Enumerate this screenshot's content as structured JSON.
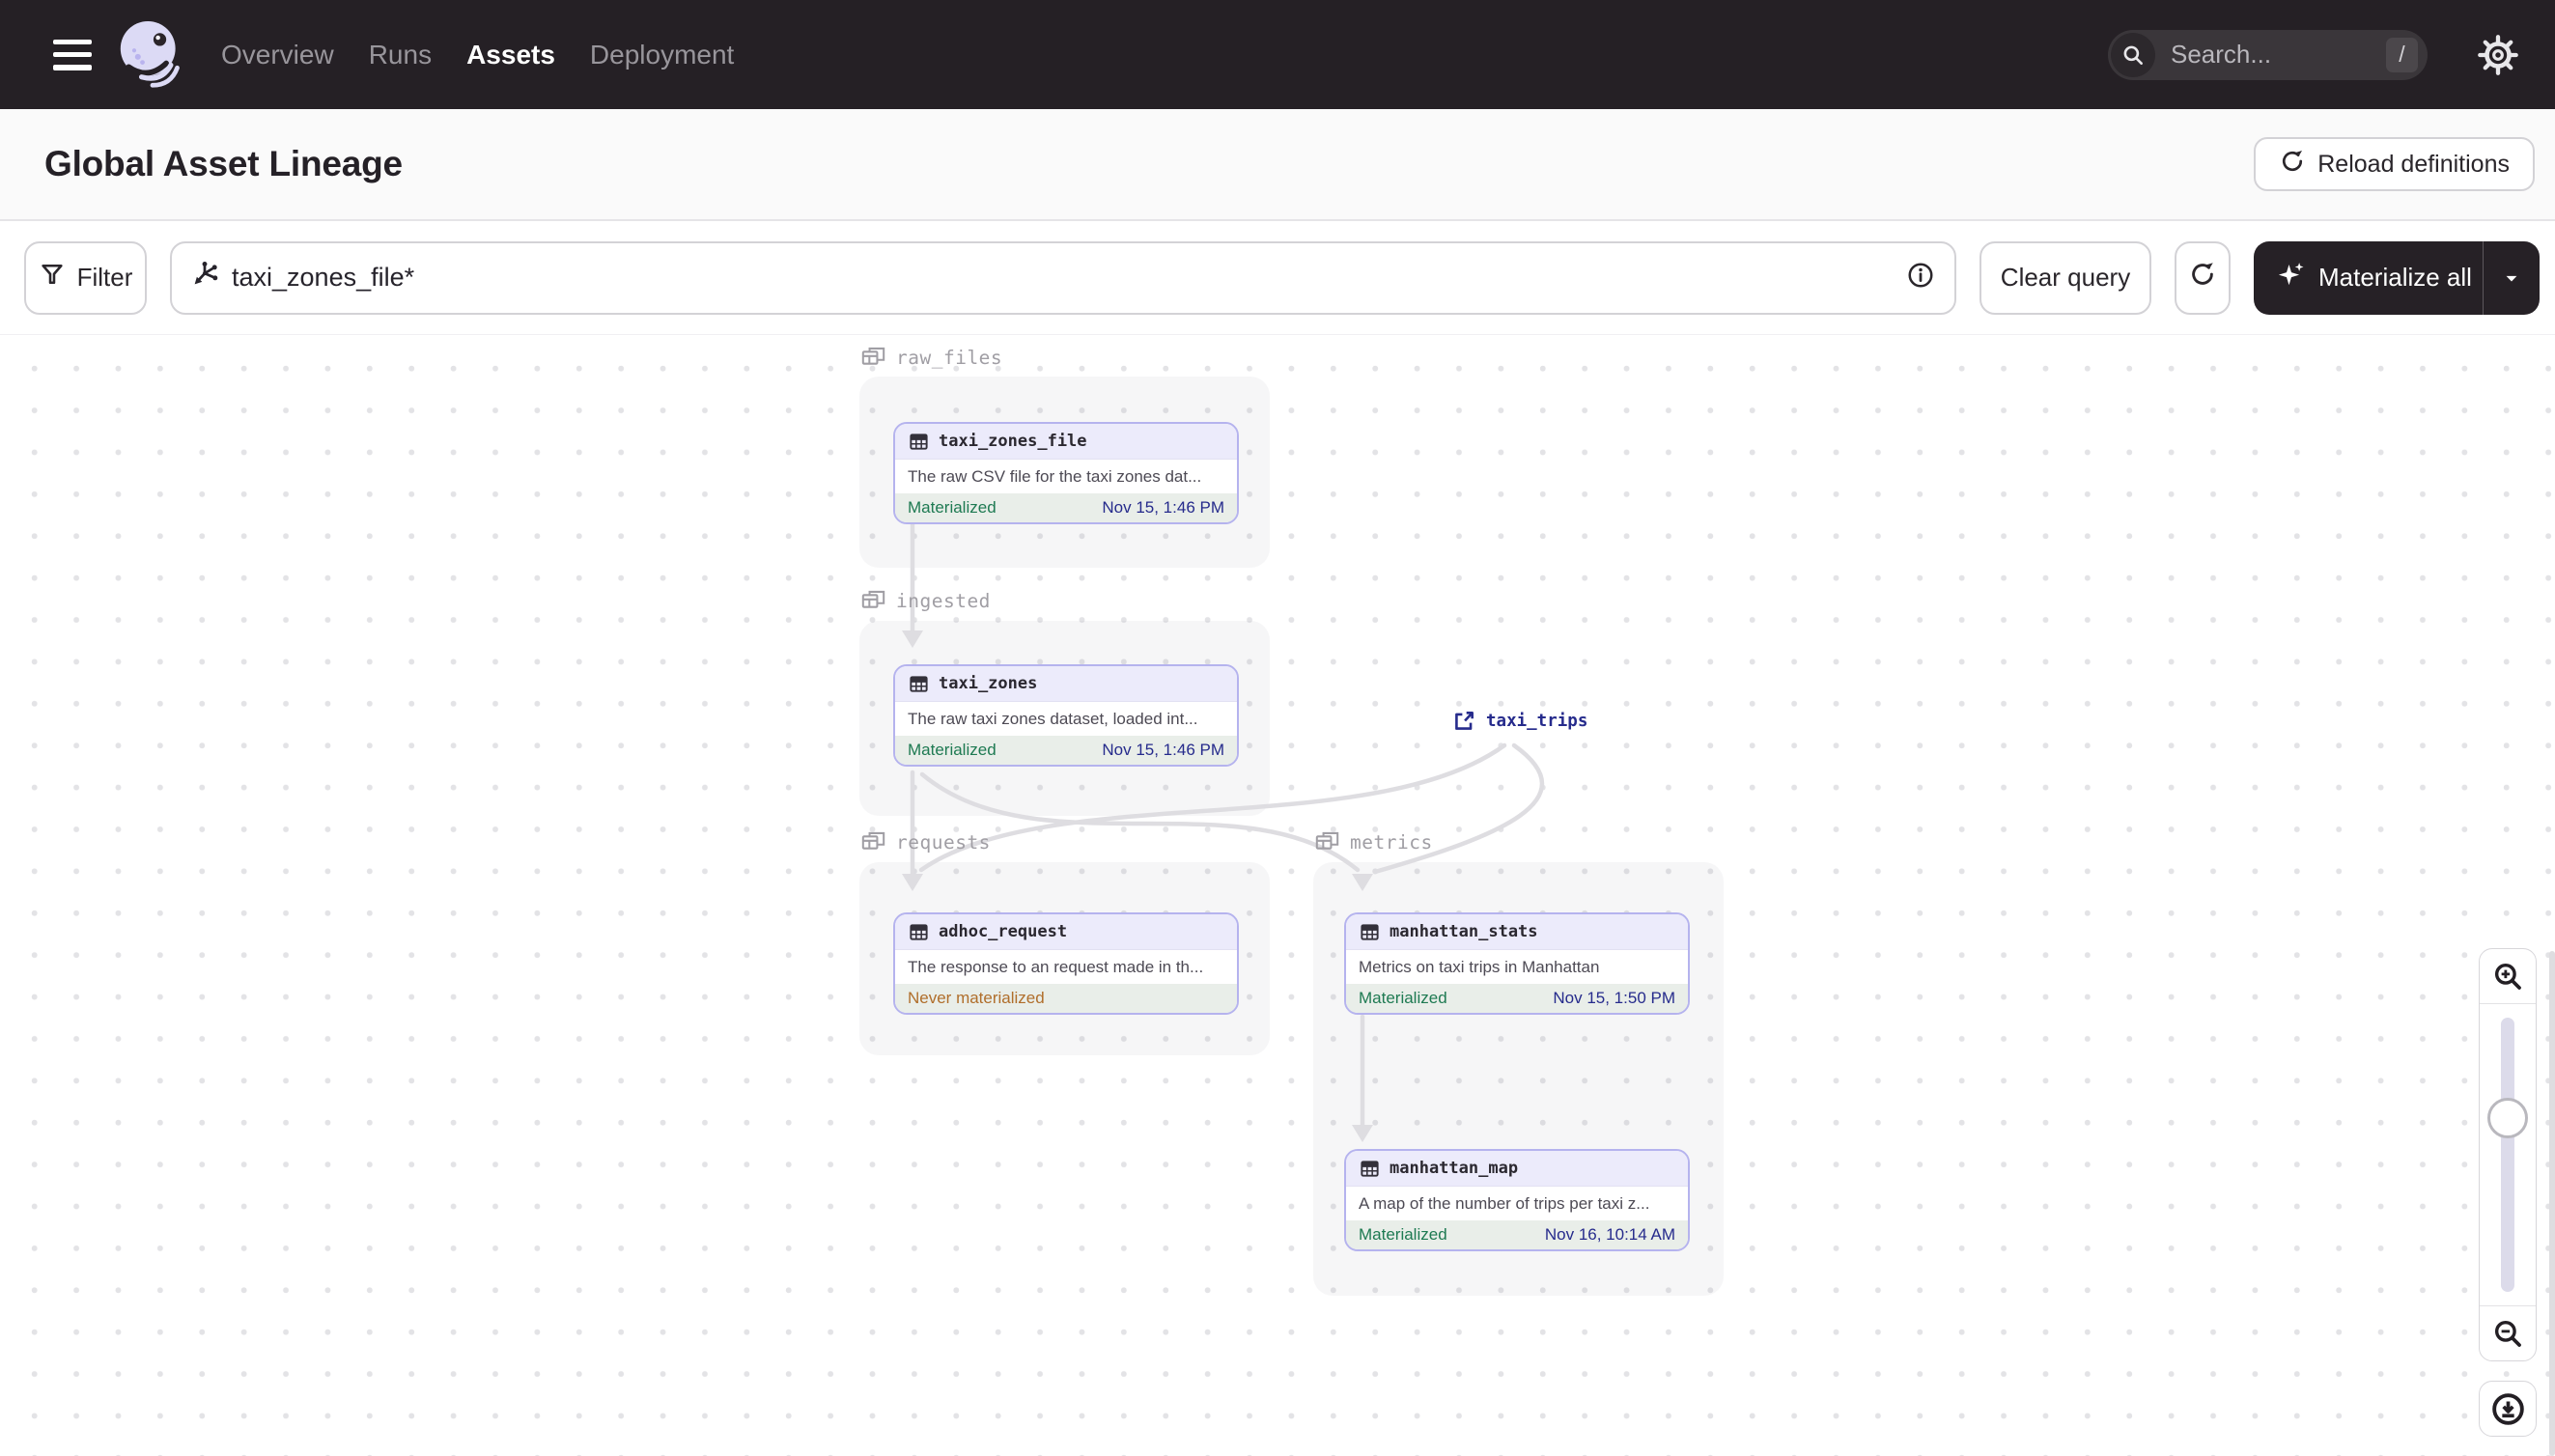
{
  "nav": {
    "items": [
      {
        "label": "Overview",
        "active": false
      },
      {
        "label": "Runs",
        "active": false
      },
      {
        "label": "Assets",
        "active": true
      },
      {
        "label": "Deployment",
        "active": false
      }
    ],
    "search": {
      "placeholder": "Search...",
      "shortcut": "/"
    }
  },
  "header": {
    "title": "Global Asset Lineage",
    "reload_button_label": "Reload definitions"
  },
  "toolbar": {
    "filter_label": "Filter",
    "query_value": "taxi_zones_file*",
    "clear_query_label": "Clear query",
    "materialize_label": "Materialize all"
  },
  "graph": {
    "groups": [
      {
        "name": "raw_files"
      },
      {
        "name": "ingested"
      },
      {
        "name": "requests"
      },
      {
        "name": "metrics"
      }
    ],
    "nodes": [
      {
        "name": "taxi_zones_file",
        "group": "raw_files",
        "description": "The raw CSV file for the taxi zones dat...",
        "status": "Materialized",
        "timestamp": "Nov 15, 1:46 PM"
      },
      {
        "name": "taxi_zones",
        "group": "ingested",
        "description": "The raw taxi zones dataset, loaded int...",
        "status": "Materialized",
        "timestamp": "Nov 15, 1:46 PM"
      },
      {
        "name": "adhoc_request",
        "group": "requests",
        "description": "The response to an request made in th...",
        "status": "Never materialized",
        "timestamp": ""
      },
      {
        "name": "manhattan_stats",
        "group": "metrics",
        "description": "Metrics on taxi trips in Manhattan",
        "status": "Materialized",
        "timestamp": "Nov 15, 1:50 PM"
      },
      {
        "name": "manhattan_map",
        "group": "metrics",
        "description": "A map of the number of trips per taxi z...",
        "status": "Materialized",
        "timestamp": "Nov 16, 10:14 AM"
      }
    ],
    "external_assets": [
      {
        "name": "taxi_trips"
      }
    ],
    "edges": [
      {
        "from": "taxi_zones_file",
        "to": "taxi_zones"
      },
      {
        "from": "taxi_zones",
        "to": "adhoc_request"
      },
      {
        "from": "taxi_zones",
        "to": "manhattan_stats"
      },
      {
        "from": "taxi_trips",
        "to": "adhoc_request"
      },
      {
        "from": "taxi_trips",
        "to": "manhattan_stats"
      },
      {
        "from": "manhattan_stats",
        "to": "manhattan_map"
      }
    ]
  },
  "colors": {
    "nav_background": "#252025",
    "accent_purple": "#B5B3EE",
    "node_header": "#ECEBFB",
    "status_green": "#1E7A52",
    "status_orange": "#B06E2B",
    "timestamp_navy": "#262B8C",
    "dark_button": "#262126",
    "edge_gray": "#DEDDE1"
  },
  "icons": [
    "hamburger-icon",
    "dagster-logo",
    "search-icon",
    "gear-icon",
    "reload-icon",
    "filter-funnel-icon",
    "asset-graph-query-icon",
    "info-icon",
    "refresh-icon",
    "sparkle-icon",
    "caret-down-icon",
    "asset-group-icon",
    "table-icon",
    "external-link-icon",
    "zoom-in-icon",
    "zoom-out-icon",
    "download-icon"
  ]
}
